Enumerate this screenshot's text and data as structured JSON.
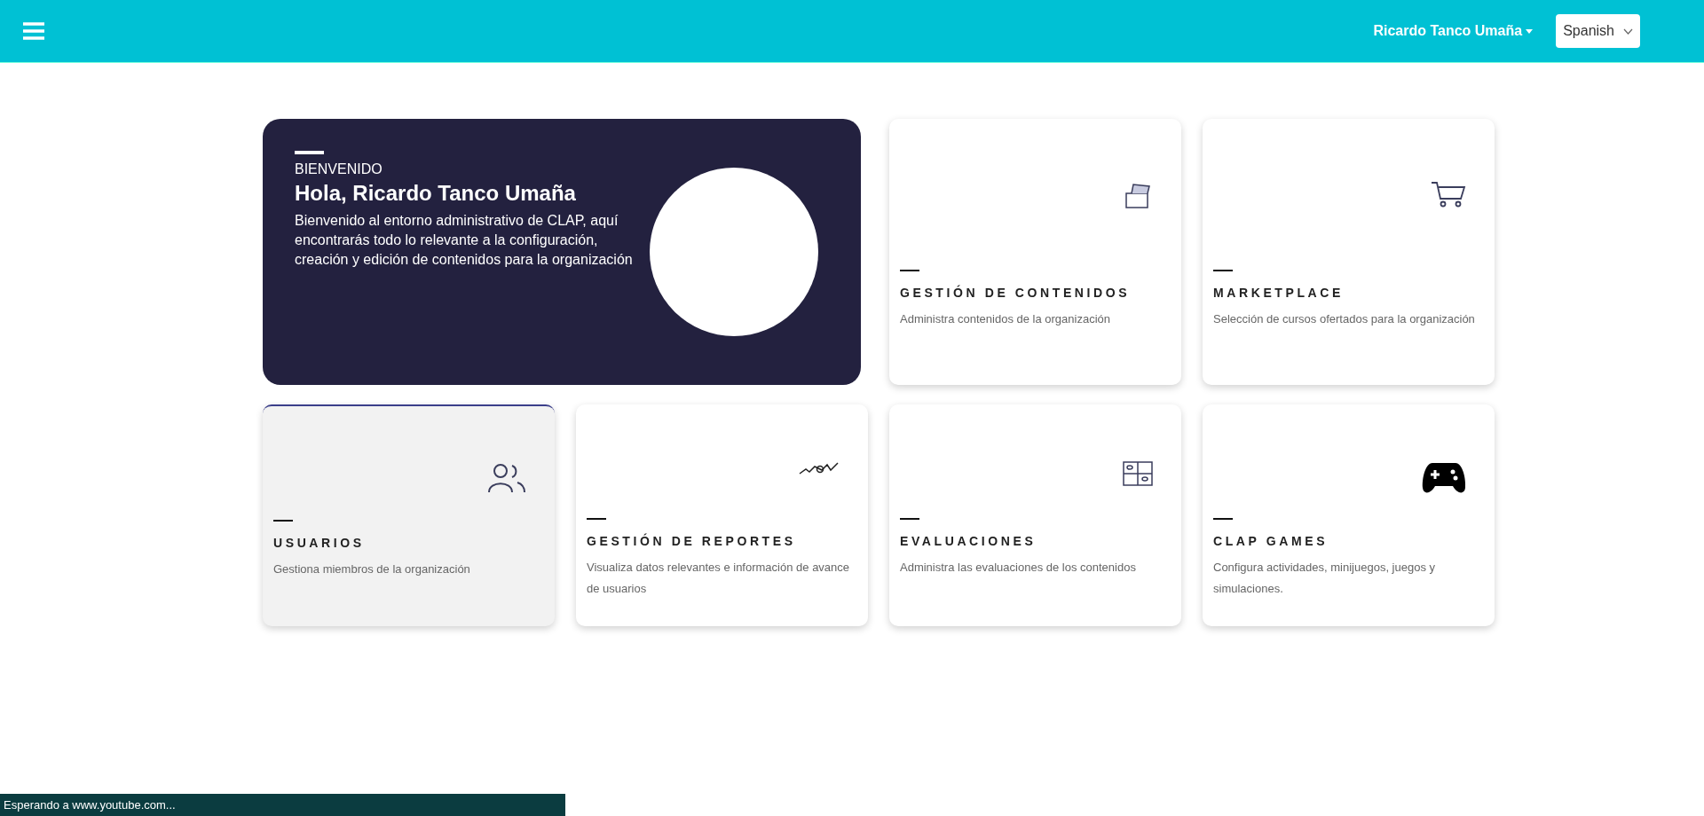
{
  "topbar": {
    "user_menu": "Ricardo Tanco Umaña",
    "language": "Spanish"
  },
  "welcome": {
    "eyebrow": "BIENVENIDO",
    "title": "Hola, Ricardo Tanco Umaña",
    "text": "Bienvenido al entorno administrativo de CLAP, aquí encontrarás todo lo relevante a la configuración, creación y edición de contenidos para la organización"
  },
  "cards": [
    {
      "title": "GESTIÓN DE CONTENIDOS",
      "description": "Administra contenidos de la organización",
      "hovered": false
    },
    {
      "title": "MARKETPLACE",
      "description": "Selección de cursos ofertados para la organización",
      "hovered": false
    },
    {
      "title": "USUARIOS",
      "description": "Gestiona miembros de la organización",
      "hovered": true
    },
    {
      "title": "GESTIÓN DE REPORTES",
      "description": "Visualiza datos relevantes e información de avance de usuarios",
      "hovered": false
    },
    {
      "title": "EVALUACIONES",
      "description": "Administra las evaluaciones de los contenidos",
      "hovered": false
    },
    {
      "title": "CLAP GAMES",
      "description": "Configura actividades, minijuegos, juegos y simulaciones.",
      "hovered": false
    }
  ],
  "status_bar": "Esperando a www.youtube.com..."
}
